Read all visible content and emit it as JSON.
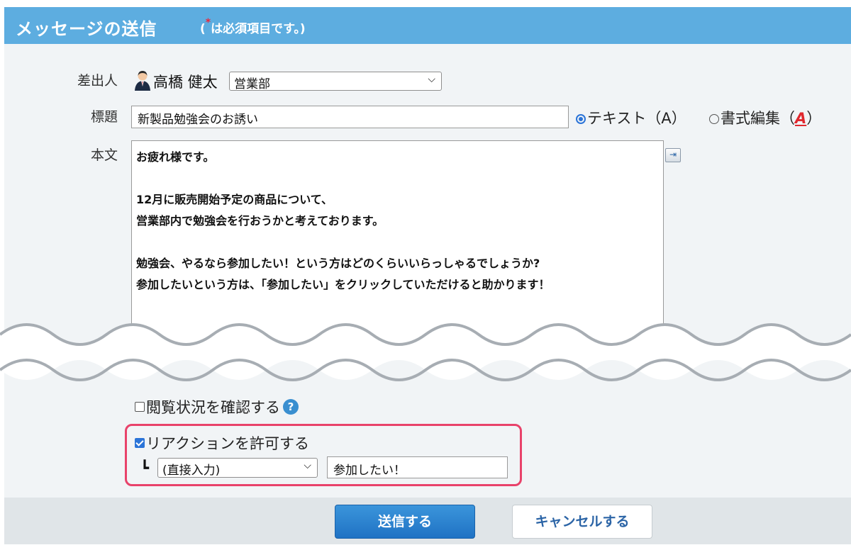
{
  "header": {
    "title": "メッセージの送信",
    "required_mark": "*",
    "required_note_prefix": "(",
    "required_note": "は必須項目です。)"
  },
  "form": {
    "sender": {
      "label": "差出人",
      "name": "高橋 健太",
      "department": "営業部"
    },
    "subject": {
      "label": "標題",
      "value": "新製品勉強会のお誘い",
      "format_text_label": "テキスト（A）",
      "format_rich_label_prefix": "書式編集（",
      "format_rich_label_a": "A",
      "format_rich_label_suffix": "）",
      "selected_format": "text"
    },
    "body": {
      "label": "本文",
      "lines": [
        "お疲れ様です。",
        "",
        "12月に販売開始予定の商品について、",
        "営業部内で勉強会を行おうかと考えております。",
        "",
        "勉強会、やるなら参加したい！という方はどのくらいいらっしゃるでしょうか?",
        "参加したいという方は、「参加したい」をクリックしていただけると助かります！"
      ]
    },
    "read_status": {
      "label": "閲覧状況を確認する",
      "checked": false,
      "help_icon": "?"
    },
    "reaction": {
      "label": "リアクションを許可する",
      "checked": true,
      "branch_glyph": "┗",
      "type_selected": "(直接入力)",
      "text_value": "参加したい！"
    }
  },
  "footer": {
    "send_label": "送信する",
    "cancel_label": "キャンセルする"
  },
  "colors": {
    "header_bg": "#5dade0",
    "panel_bg": "#f1f4f6",
    "accent": "#2b74d8",
    "highlight": "#e8426a",
    "send_button": "#2a84d2"
  }
}
